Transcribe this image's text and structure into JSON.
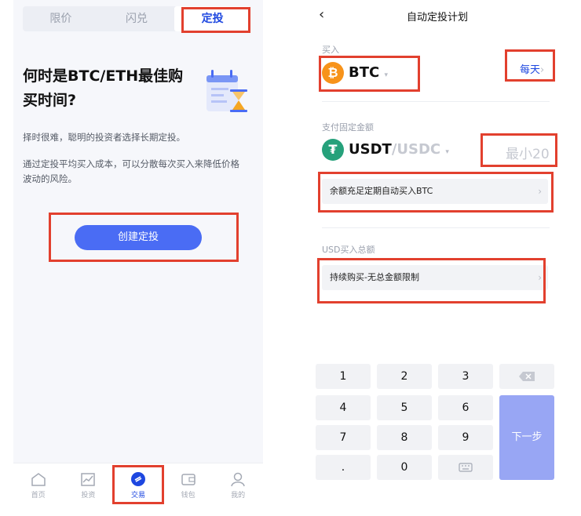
{
  "left": {
    "segments": [
      "限价",
      "闪兑",
      "定投"
    ],
    "active_segment": "定投",
    "headline_line1": "何时是BTC/ETH最佳购",
    "headline_line2": "买时间?",
    "para1": "择时很难，聪明的投资者选择长期定投。",
    "para2": "通过定投平均买入成本，可以分散每次买入来降低价格",
    "para3": "波动的风险。",
    "cta": "创建定投",
    "tabs": [
      {
        "label": "首页",
        "icon": "home-icon"
      },
      {
        "label": "投资",
        "icon": "chart-icon"
      },
      {
        "label": "交易",
        "icon": "trade-icon"
      },
      {
        "label": "钱包",
        "icon": "wallet-icon"
      },
      {
        "label": "我的",
        "icon": "profile-icon"
      }
    ],
    "active_tab": "交易"
  },
  "right": {
    "title": "自动定投计划",
    "buy_label": "买入",
    "buy_coin": "BTC",
    "frequency": "每天",
    "pay_label": "支付固定金额",
    "pay_coin": "USDT",
    "pay_alt": "/USDC",
    "amount_placeholder": "最小20",
    "auto_row": "余额充足定期自动买入BTC",
    "total_label": "USD买入总额",
    "total_row": "持续购买-无总金额限制",
    "keys": [
      "1",
      "2",
      "3",
      "4",
      "5",
      "6",
      "7",
      "8",
      "9",
      ".",
      "0"
    ],
    "next": "下一步"
  },
  "colors": {
    "accent": "#1d47e0",
    "button": "#4a6cf4",
    "highlight": "#e2402e",
    "btc": "#f7931a",
    "usdt": "#26a17b"
  }
}
